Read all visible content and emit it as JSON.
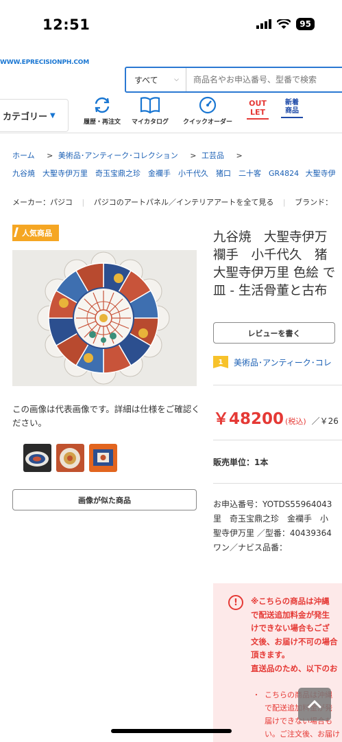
{
  "status_bar": {
    "time": "12:51",
    "battery": "95"
  },
  "header": {
    "logo": "WWW.EPRECISIONPH.COM",
    "search": {
      "category": "すべて",
      "placeholder": "商品名やお申込番号、型番で検索"
    },
    "category_button": "カテゴリー",
    "nav": {
      "history": "履歴・再注文",
      "catalog": "マイカタログ",
      "quick_order": "クイックオーダー",
      "outlet_line1": "OUT",
      "outlet_line2": "LET",
      "new_line1": "新着",
      "new_line2": "商品"
    }
  },
  "breadcrumb": {
    "line1": [
      "ホーム",
      "美術品･アンティーク･コレクション",
      "工芸品"
    ],
    "line2": "九谷焼　大聖寺伊万里　奇玉宝鼎之珍　金襴手　小千代久　猪口　二十客　GR4824 大聖寺伊"
  },
  "maker": {
    "label": "メーカー：パジコ",
    "link": "パジコのアートパネル／インテリアアートを全て見る",
    "brand": "ブランド："
  },
  "product": {
    "popular_badge": "人気商品",
    "image_note": "この画像は代表画像です。詳細は仕様をご確認ください。",
    "similar_button": "画像が似た商品",
    "title_lines": [
      "九谷焼　大聖寺伊万",
      "襴手　小千代久　猪",
      "大聖寺伊万里 色絵 で",
      "皿 - 生活骨董と古布"
    ],
    "review_button": "レビューを書く",
    "rank_number": "1",
    "rank_text": "美術品･アンティーク･コレ",
    "price": "￥48200",
    "price_tax": "(税込)",
    "price_other": "／￥26",
    "unit": "販売単位：1本",
    "order_info_lines": [
      "お申込番号：YOTDS55964043",
      "里　奇玉宝鼎之珍　金襴手　小",
      "聖寺伊万里 ／型番：40439364",
      "ワン／ナビス品番："
    ]
  },
  "notice": {
    "icon": "!",
    "lines": [
      "※こちらの商品は沖縄",
      "で配送追加料金が発生",
      "けできない場合もござ",
      "文後、お届け不可の場合",
      "頂きます。",
      "直送品のため、以下のお"
    ],
    "sub_lines": [
      "こちらの商品は沖縄",
      "で配送追加料金が発",
      "届けできない場合も",
      "い。ご注文後、お届け"
    ],
    "bullet": "・"
  },
  "colors": {
    "accent": "#1976d2",
    "price": "#e53935",
    "badge": "#f5a623",
    "notice_bg": "#fde9e9"
  }
}
